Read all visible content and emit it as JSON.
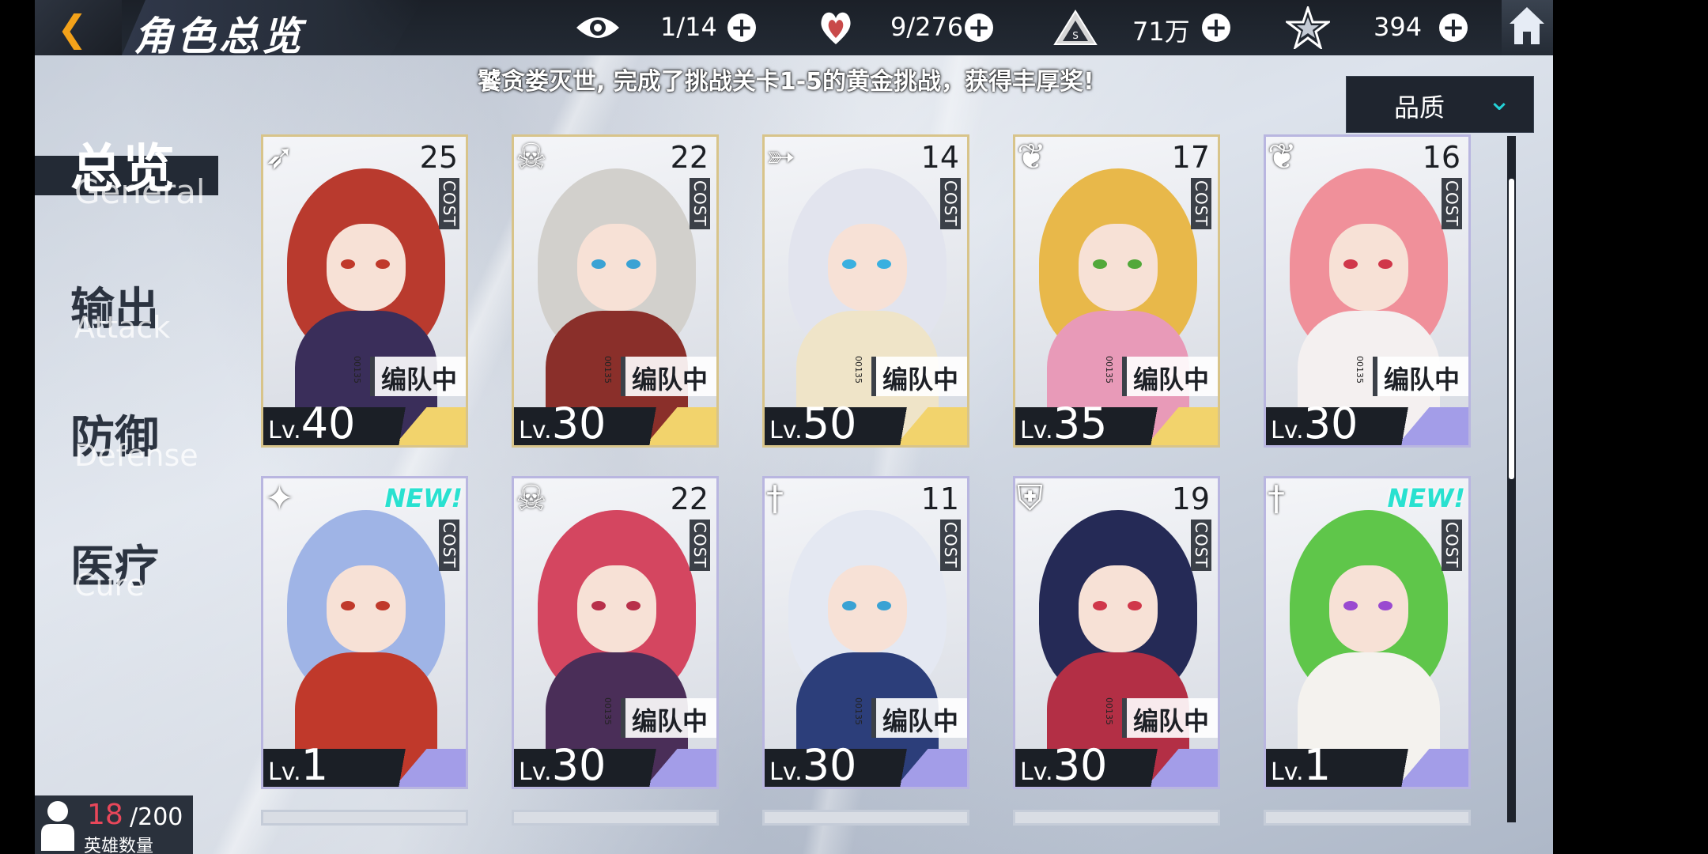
{
  "page_title": "角色总览",
  "resources": [
    {
      "icon": "eye-icon",
      "value": "1/14"
    },
    {
      "icon": "heart-icon",
      "value": "9/276"
    },
    {
      "icon": "triangle-emblem-icon",
      "value": "71万"
    },
    {
      "icon": "star-emblem-icon",
      "value": "394"
    }
  ],
  "banner_text": "饕贪娄灭世, 完成了挑战关卡1-5的黄金挑战，获得丰厚奖!",
  "sort_dropdown": {
    "label": "品质"
  },
  "categories": [
    {
      "cn": "总览",
      "en": "General"
    },
    {
      "cn": "输出",
      "en": "Attack"
    },
    {
      "cn": "防御",
      "en": "Defense"
    },
    {
      "cn": "医疗",
      "en": "Cure"
    }
  ],
  "cost_label": "COST",
  "team_label": "编队中",
  "barcode_text": "00135",
  "level_prefix": "Lv.",
  "new_label": "NEW!",
  "heroes": [
    {
      "cost": "25",
      "level": "40",
      "in_team": true,
      "is_new": false,
      "class_icon": "bow-icon",
      "rarity": "gold"
    },
    {
      "cost": "22",
      "level": "30",
      "in_team": true,
      "is_new": false,
      "class_icon": "horned-skull-icon",
      "rarity": "gold"
    },
    {
      "cost": "14",
      "level": "50",
      "in_team": true,
      "is_new": false,
      "class_icon": "crossbow-icon",
      "rarity": "gold"
    },
    {
      "cost": "17",
      "level": "35",
      "in_team": true,
      "is_new": false,
      "class_icon": "heal-wing-icon",
      "rarity": "gold"
    },
    {
      "cost": "16",
      "level": "30",
      "in_team": true,
      "is_new": false,
      "class_icon": "heal-wing-icon",
      "rarity": "purple"
    },
    {
      "cost": "",
      "level": "1",
      "in_team": false,
      "is_new": true,
      "class_icon": "shuriken-icon",
      "rarity": "purple"
    },
    {
      "cost": "22",
      "level": "30",
      "in_team": true,
      "is_new": false,
      "class_icon": "horned-skull-icon",
      "rarity": "purple"
    },
    {
      "cost": "11",
      "level": "30",
      "in_team": true,
      "is_new": false,
      "class_icon": "sword-icon",
      "rarity": "purple"
    },
    {
      "cost": "19",
      "level": "30",
      "in_team": true,
      "is_new": false,
      "class_icon": "shield-icon",
      "rarity": "purple"
    },
    {
      "cost": "",
      "level": "1",
      "in_team": false,
      "is_new": true,
      "class_icon": "sword-icon",
      "rarity": "purple"
    }
  ],
  "hero_count": {
    "current": "18",
    "max": "/200",
    "label": "英雄数量"
  },
  "colors": {
    "gold": "#f2d36c",
    "purple": "#a39de8",
    "accent": "#24d1d6",
    "back": "#f3a21a"
  }
}
